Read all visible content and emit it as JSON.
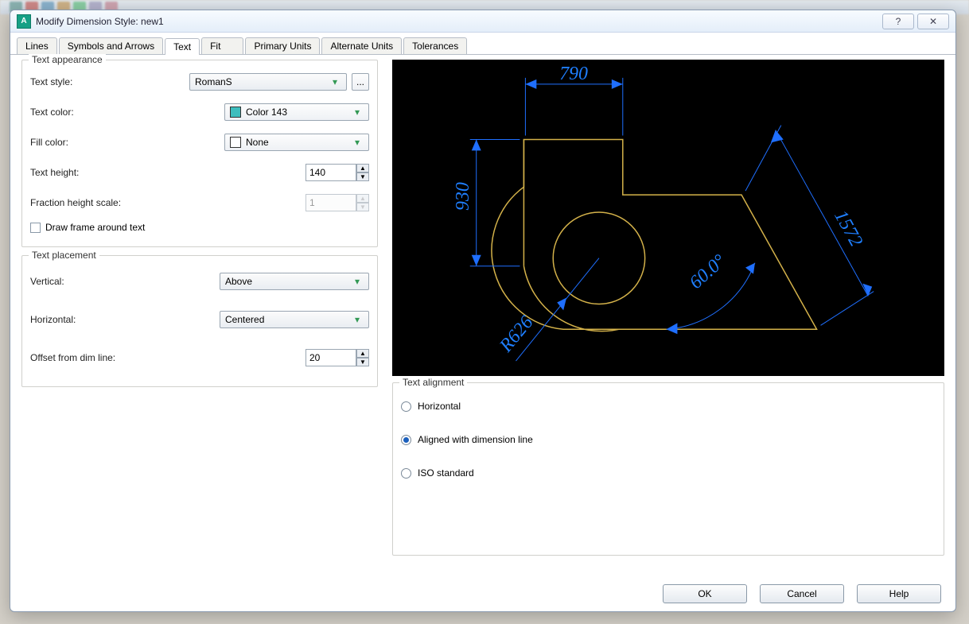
{
  "window": {
    "title": "Modify Dimension Style: new1",
    "help_tooltip": "?",
    "close_tooltip": "✕"
  },
  "tabs": [
    {
      "label": "Lines"
    },
    {
      "label": "Symbols and Arrows"
    },
    {
      "label": "Text"
    },
    {
      "label": "Fit"
    },
    {
      "label": "Primary Units"
    },
    {
      "label": "Alternate Units"
    },
    {
      "label": "Tolerances"
    }
  ],
  "active_tab": "Text",
  "appearance": {
    "legend": "Text appearance",
    "text_style_label": "Text style:",
    "text_style_value": "RomanS",
    "ellipsis": "...",
    "text_color_label": "Text color:",
    "text_color_value": "Color 143",
    "text_color_swatch": "#3dbdbd",
    "fill_color_label": "Fill color:",
    "fill_color_value": "None",
    "fill_color_swatch": "#ffffff",
    "text_height_label": "Text height:",
    "text_height_value": "140",
    "fraction_scale_label": "Fraction height scale:",
    "fraction_scale_value": "1",
    "draw_frame_label": "Draw frame around text",
    "draw_frame_checked": false
  },
  "placement": {
    "legend": "Text placement",
    "vertical_label": "Vertical:",
    "vertical_value": "Above",
    "horizontal_label": "Horizontal:",
    "horizontal_value": "Centered",
    "offset_label": "Offset from dim line:",
    "offset_value": "20"
  },
  "alignment": {
    "legend": "Text alignment",
    "options": [
      {
        "label": "Horizontal"
      },
      {
        "label": "Aligned with dimension line"
      },
      {
        "label": "ISO standard"
      }
    ],
    "selected": "Aligned with dimension line"
  },
  "preview": {
    "dim_top": "790",
    "dim_left": "930",
    "dim_diag": "1572",
    "dim_angle": "60.0°",
    "dim_radius": "R626"
  },
  "buttons": {
    "ok": "OK",
    "cancel": "Cancel",
    "help": "Help"
  }
}
